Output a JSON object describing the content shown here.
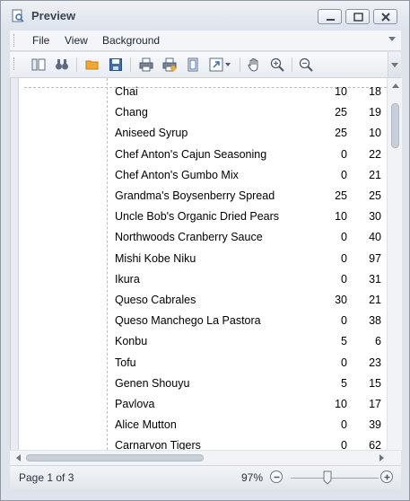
{
  "window": {
    "title": "Preview"
  },
  "menu": {
    "items": [
      "File",
      "View",
      "Background"
    ]
  },
  "toolbar": {
    "icons": [
      "document-map-icon",
      "binoculars-icon",
      "open-folder-icon",
      "save-icon",
      "print-icon",
      "quick-print-icon",
      "page-setup-icon",
      "scale-icon",
      "hand-tool-icon",
      "zoom-in-icon",
      "zoom-out-icon"
    ]
  },
  "report": {
    "rows": [
      {
        "name": "Chai",
        "a": "10",
        "b": "18"
      },
      {
        "name": "Chang",
        "a": "25",
        "b": "19"
      },
      {
        "name": "Aniseed Syrup",
        "a": "25",
        "b": "10"
      },
      {
        "name": "Chef Anton's Cajun Seasoning",
        "a": "0",
        "b": "22"
      },
      {
        "name": "Chef Anton's Gumbo Mix",
        "a": "0",
        "b": "21"
      },
      {
        "name": "Grandma's Boysenberry Spread",
        "a": "25",
        "b": "25"
      },
      {
        "name": "Uncle Bob's Organic Dried Pears",
        "a": "10",
        "b": "30"
      },
      {
        "name": "Northwoods Cranberry Sauce",
        "a": "0",
        "b": "40"
      },
      {
        "name": "Mishi Kobe Niku",
        "a": "0",
        "b": "97"
      },
      {
        "name": "Ikura",
        "a": "0",
        "b": "31"
      },
      {
        "name": "Queso Cabrales",
        "a": "30",
        "b": "21"
      },
      {
        "name": "Queso Manchego La Pastora",
        "a": "0",
        "b": "38"
      },
      {
        "name": "Konbu",
        "a": "5",
        "b": "6"
      },
      {
        "name": "Tofu",
        "a": "0",
        "b": "23"
      },
      {
        "name": "Genen Shouyu",
        "a": "5",
        "b": "15"
      },
      {
        "name": "Pavlova",
        "a": "10",
        "b": "17"
      },
      {
        "name": "Alice Mutton",
        "a": "0",
        "b": "39"
      },
      {
        "name": "Carnarvon Tigers",
        "a": "0",
        "b": "62"
      }
    ]
  },
  "status": {
    "page": "Page 1 of 3",
    "zoom": "97%"
  },
  "colors": {
    "accent": "#3a6fb2",
    "window_bg": "#dfe4ec"
  }
}
